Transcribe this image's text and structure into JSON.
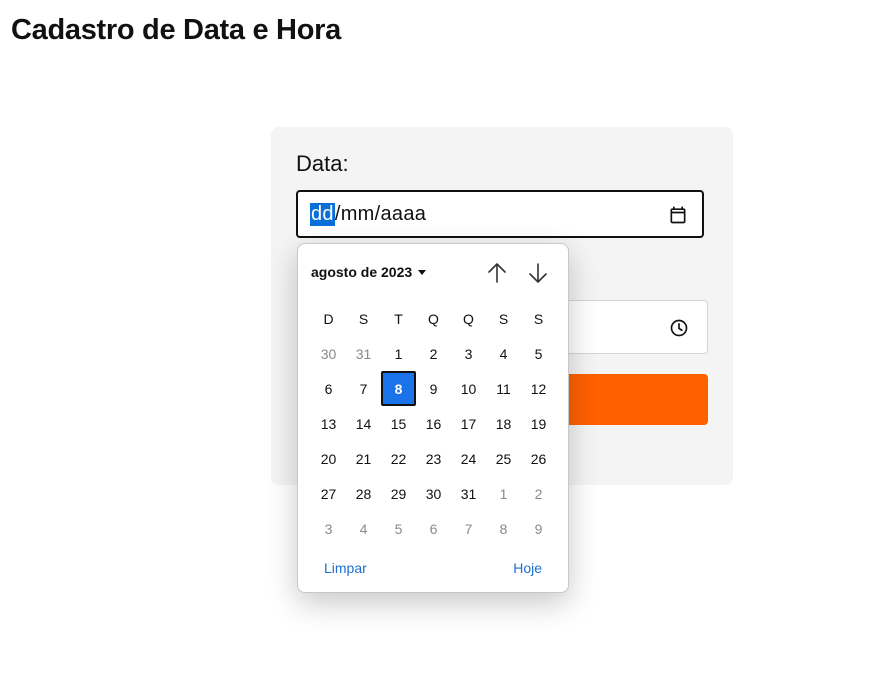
{
  "page": {
    "title": "Cadastro de Data e Hora"
  },
  "form": {
    "date_label": "Data:",
    "date_input": {
      "day_placeholder": "dd",
      "sep1": "/",
      "month_placeholder": "mm",
      "sep2": "/",
      "year_placeholder": "aaaa"
    },
    "submit_color": "#ff6000"
  },
  "datepicker": {
    "month_label": "agosto de 2023",
    "weekdays": [
      "D",
      "S",
      "T",
      "Q",
      "Q",
      "S",
      "S"
    ],
    "weeks": [
      [
        {
          "d": "30",
          "muted": true
        },
        {
          "d": "31",
          "muted": true
        },
        {
          "d": "1"
        },
        {
          "d": "2"
        },
        {
          "d": "3"
        },
        {
          "d": "4"
        },
        {
          "d": "5"
        }
      ],
      [
        {
          "d": "6"
        },
        {
          "d": "7"
        },
        {
          "d": "8",
          "selected": true
        },
        {
          "d": "9"
        },
        {
          "d": "10"
        },
        {
          "d": "11"
        },
        {
          "d": "12"
        }
      ],
      [
        {
          "d": "13"
        },
        {
          "d": "14"
        },
        {
          "d": "15"
        },
        {
          "d": "16"
        },
        {
          "d": "17"
        },
        {
          "d": "18"
        },
        {
          "d": "19"
        }
      ],
      [
        {
          "d": "20"
        },
        {
          "d": "21"
        },
        {
          "d": "22"
        },
        {
          "d": "23"
        },
        {
          "d": "24"
        },
        {
          "d": "25"
        },
        {
          "d": "26"
        }
      ],
      [
        {
          "d": "27"
        },
        {
          "d": "28"
        },
        {
          "d": "29"
        },
        {
          "d": "30"
        },
        {
          "d": "31"
        },
        {
          "d": "1",
          "muted": true
        },
        {
          "d": "2",
          "muted": true
        }
      ],
      [
        {
          "d": "3",
          "muted": true
        },
        {
          "d": "4",
          "muted": true
        },
        {
          "d": "5",
          "muted": true
        },
        {
          "d": "6",
          "muted": true
        },
        {
          "d": "7",
          "muted": true
        },
        {
          "d": "8",
          "muted": true
        },
        {
          "d": "9",
          "muted": true
        }
      ]
    ],
    "clear_label": "Limpar",
    "today_label": "Hoje",
    "accent_color": "#1a73e8"
  }
}
